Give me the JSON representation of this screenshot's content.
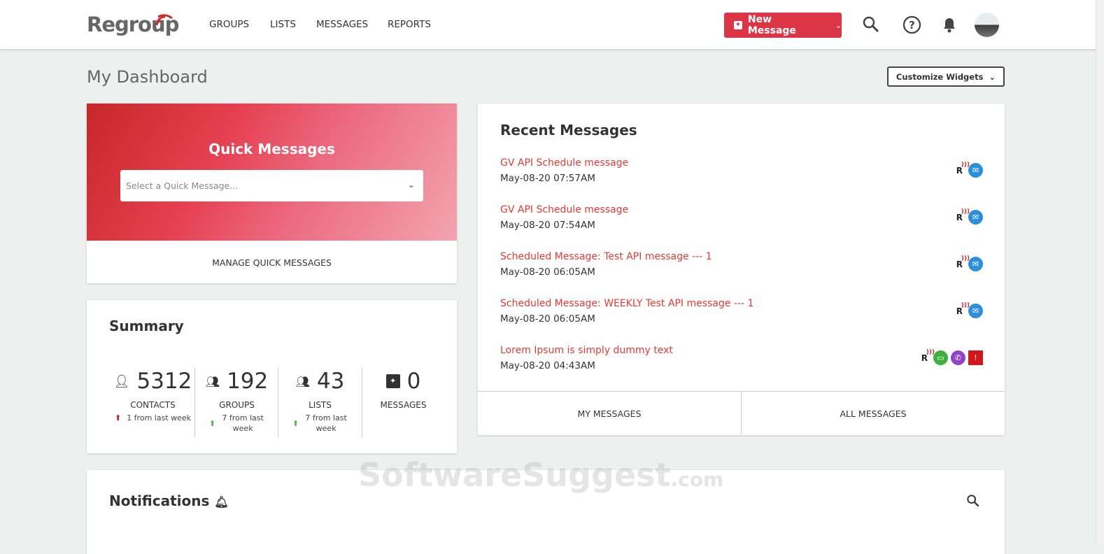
{
  "header": {
    "logo": "Regroup",
    "nav": [
      "GROUPS",
      "LISTS",
      "MESSAGES",
      "REPORTS"
    ],
    "new_message": "New Message"
  },
  "page": {
    "title": "My Dashboard",
    "customize": "Customize Widgets"
  },
  "quick": {
    "title": "Quick Messages",
    "placeholder": "Select a Quick Message...",
    "manage": "MANAGE QUICK MESSAGES"
  },
  "summary": {
    "title": "Summary",
    "stats": [
      {
        "value": "5312",
        "label": "CONTACTS",
        "change": "1 from last week",
        "trend": "up-red"
      },
      {
        "value": "192",
        "label": "GROUPS",
        "change": "7 from last week",
        "trend": "up-green"
      },
      {
        "value": "43",
        "label": "LISTS",
        "change": "7 from last week",
        "trend": "up-green"
      },
      {
        "value": "0",
        "label": "MESSAGES"
      }
    ]
  },
  "recent": {
    "title": "Recent Messages",
    "items": [
      {
        "title": "GV API Schedule message",
        "date": "May-08-20 07:57AM"
      },
      {
        "title": "GV API Schedule message",
        "date": "May-08-20 07:54AM"
      },
      {
        "title": "Scheduled Message: Test API message --- 1",
        "date": "May-08-20 06:05AM"
      },
      {
        "title": "Scheduled Message: WEEKLY Test API message --- 1",
        "date": "May-08-20 06:05AM"
      },
      {
        "title": "Lorem Ipsum is simply dummy text",
        "date": "May-08-20 04:43AM"
      }
    ],
    "my": "MY MESSAGES",
    "all": "ALL MESSAGES"
  },
  "notifications": {
    "title": "Notifications"
  },
  "watermark": {
    "text": "SoftwareSuggest",
    "suffix": ".com"
  },
  "colors": {
    "accent": "#dc3545",
    "link": "#e53935",
    "email": "#2d8fdc",
    "sms": "#3faf3f",
    "voice": "#8e44c4",
    "alert": "#d0191b"
  }
}
